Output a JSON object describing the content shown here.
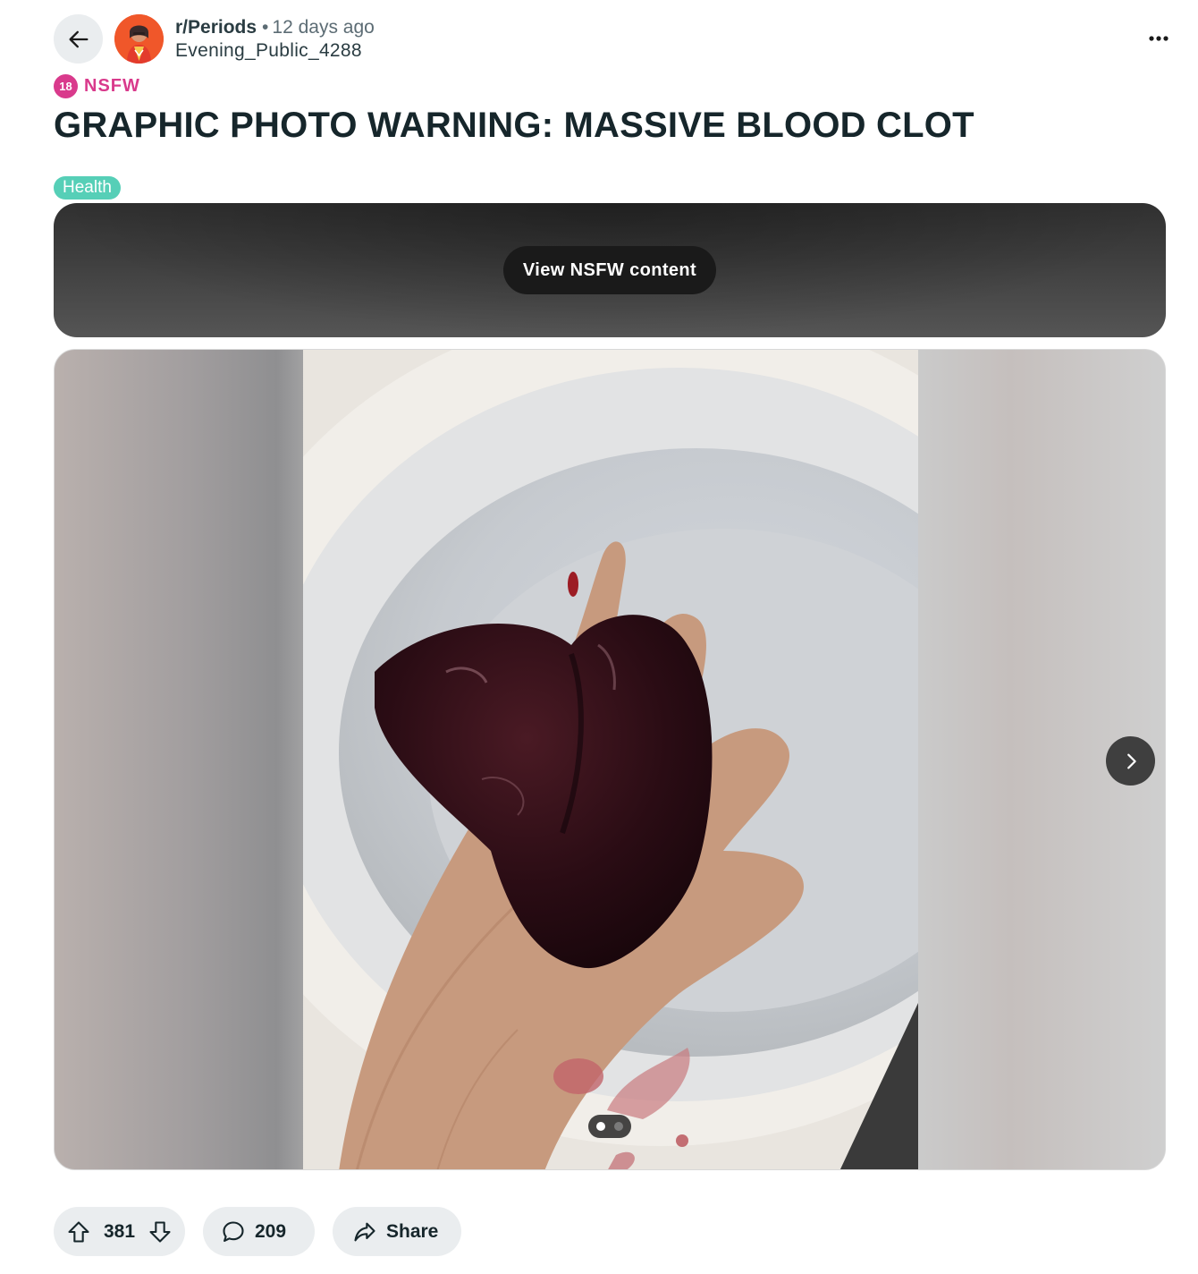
{
  "post": {
    "subreddit": "r/Periods",
    "separator": "•",
    "time_ago": "12 days ago",
    "author": "Evening_Public_4288",
    "nsfw_badge": "18",
    "nsfw_label": "NSFW",
    "title": "GRAPHIC PHOTO WARNING: MASSIVE BLOOD CLOT",
    "flair": "Health",
    "flair_color": "#56cfb7",
    "nsfw_color": "#d93a8c"
  },
  "nsfw_banner": {
    "button_label": "View NSFW content"
  },
  "gallery": {
    "page_count": 2,
    "active_page": 1
  },
  "actions": {
    "upvotes": "381",
    "comments": "209",
    "share_label": "Share"
  },
  "icons": {
    "back": "arrow-left-icon",
    "overflow": "more-horizontal-icon",
    "next": "chevron-right-icon",
    "upvote": "upvote-arrow-icon",
    "downvote": "downvote-arrow-icon",
    "comment": "speech-bubble-icon",
    "share": "share-arrow-icon"
  }
}
